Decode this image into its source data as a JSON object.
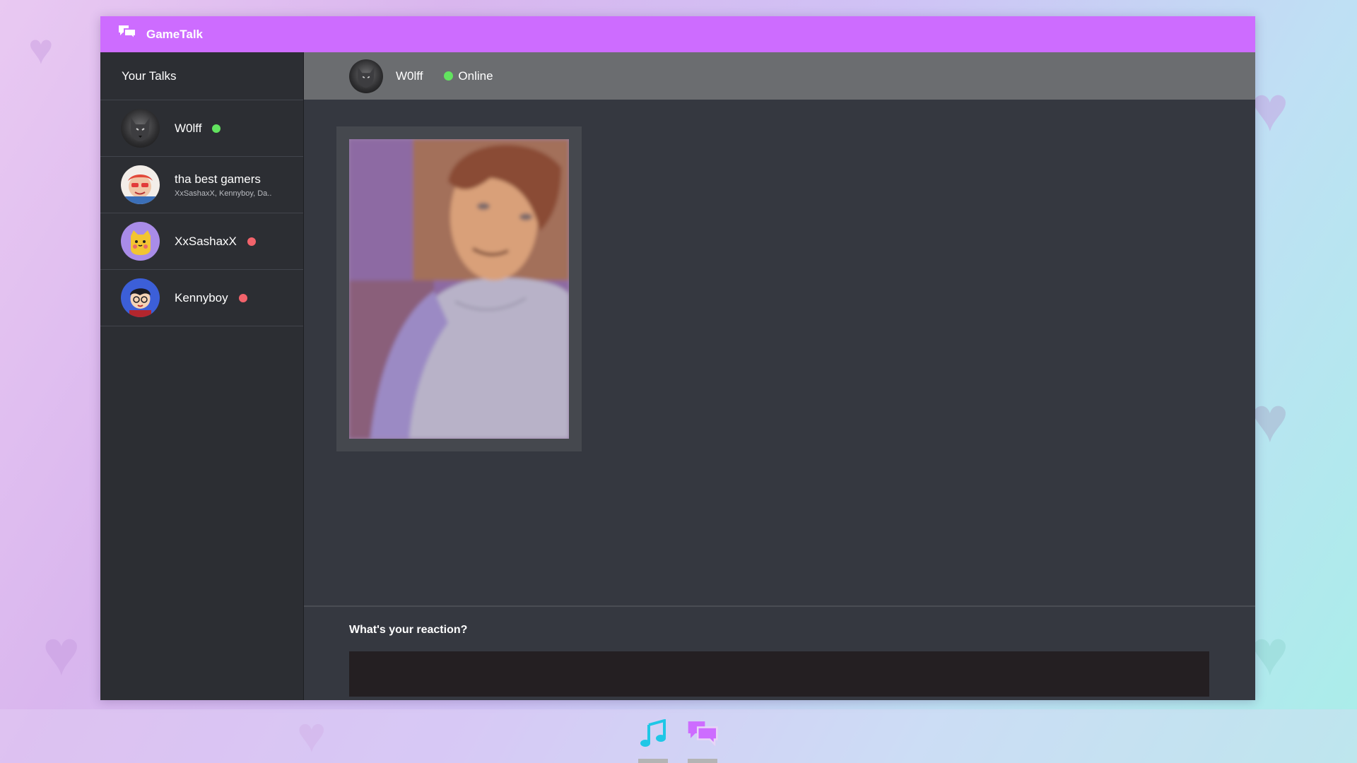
{
  "app": {
    "name": "GameTalk",
    "icon": "chat-bubbles-icon"
  },
  "sidebar": {
    "title": "Your Talks",
    "items": [
      {
        "name": "W0lff",
        "status": "online",
        "status_color": "#62e35f",
        "avatar": "wolf-avatar"
      },
      {
        "name": "tha best gamers",
        "members": "XxSashaxX, Kennyboy, Da..",
        "avatar": "group-avatar"
      },
      {
        "name": "XxSashaxX",
        "status": "offline",
        "status_color": "#f2636b",
        "avatar": "cat-avatar"
      },
      {
        "name": "Kennyboy",
        "status": "offline",
        "status_color": "#f2636b",
        "avatar": "boy-avatar"
      }
    ]
  },
  "chat": {
    "contact_name": "W0lff",
    "status_text": "Online",
    "status_color": "#62e35f",
    "message": {
      "type": "image",
      "description_icon": "anime-boy-image"
    }
  },
  "reaction": {
    "label": "What's your reaction?",
    "input_value": "",
    "placeholder": ""
  },
  "taskbar": {
    "items": [
      {
        "icon": "music-note-icon",
        "color": "#1fc7e6"
      },
      {
        "icon": "chat-bubbles-icon",
        "color": "#cd6cff"
      }
    ]
  },
  "colors": {
    "accent": "#cd6cff",
    "online": "#62e35f",
    "offline": "#f2636b"
  }
}
